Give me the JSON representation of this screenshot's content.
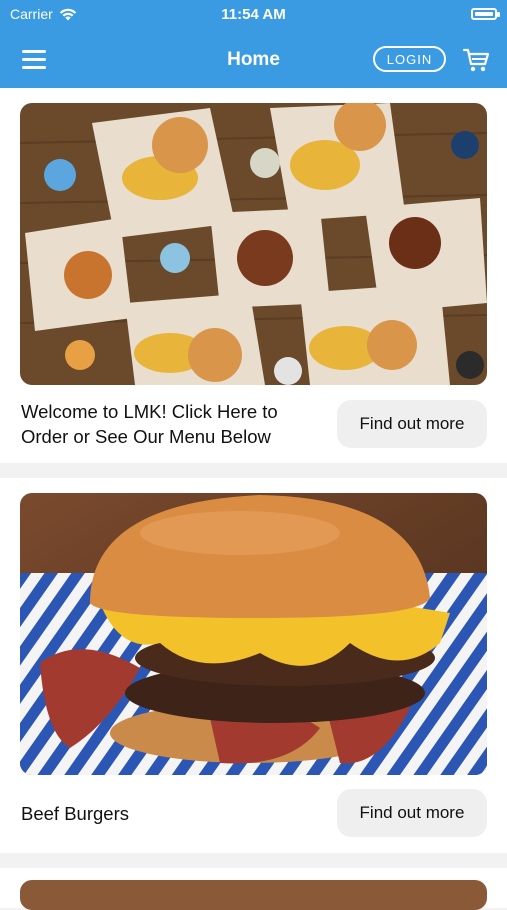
{
  "status_bar": {
    "carrier": "Carrier",
    "time": "11:54 AM"
  },
  "header": {
    "title": "Home",
    "login_label": "LOGIN"
  },
  "cards": [
    {
      "text": "Welcome to LMK! Click Here to Order or See Our Menu Below",
      "button_label": "Find out more"
    },
    {
      "text": "Beef Burgers",
      "button_label": "Find out more"
    }
  ],
  "colors": {
    "accent": "#3a9be3",
    "button_bg": "#efefef"
  },
  "icons": [
    "menu-icon",
    "cart-icon",
    "wifi-icon",
    "battery-icon"
  ]
}
